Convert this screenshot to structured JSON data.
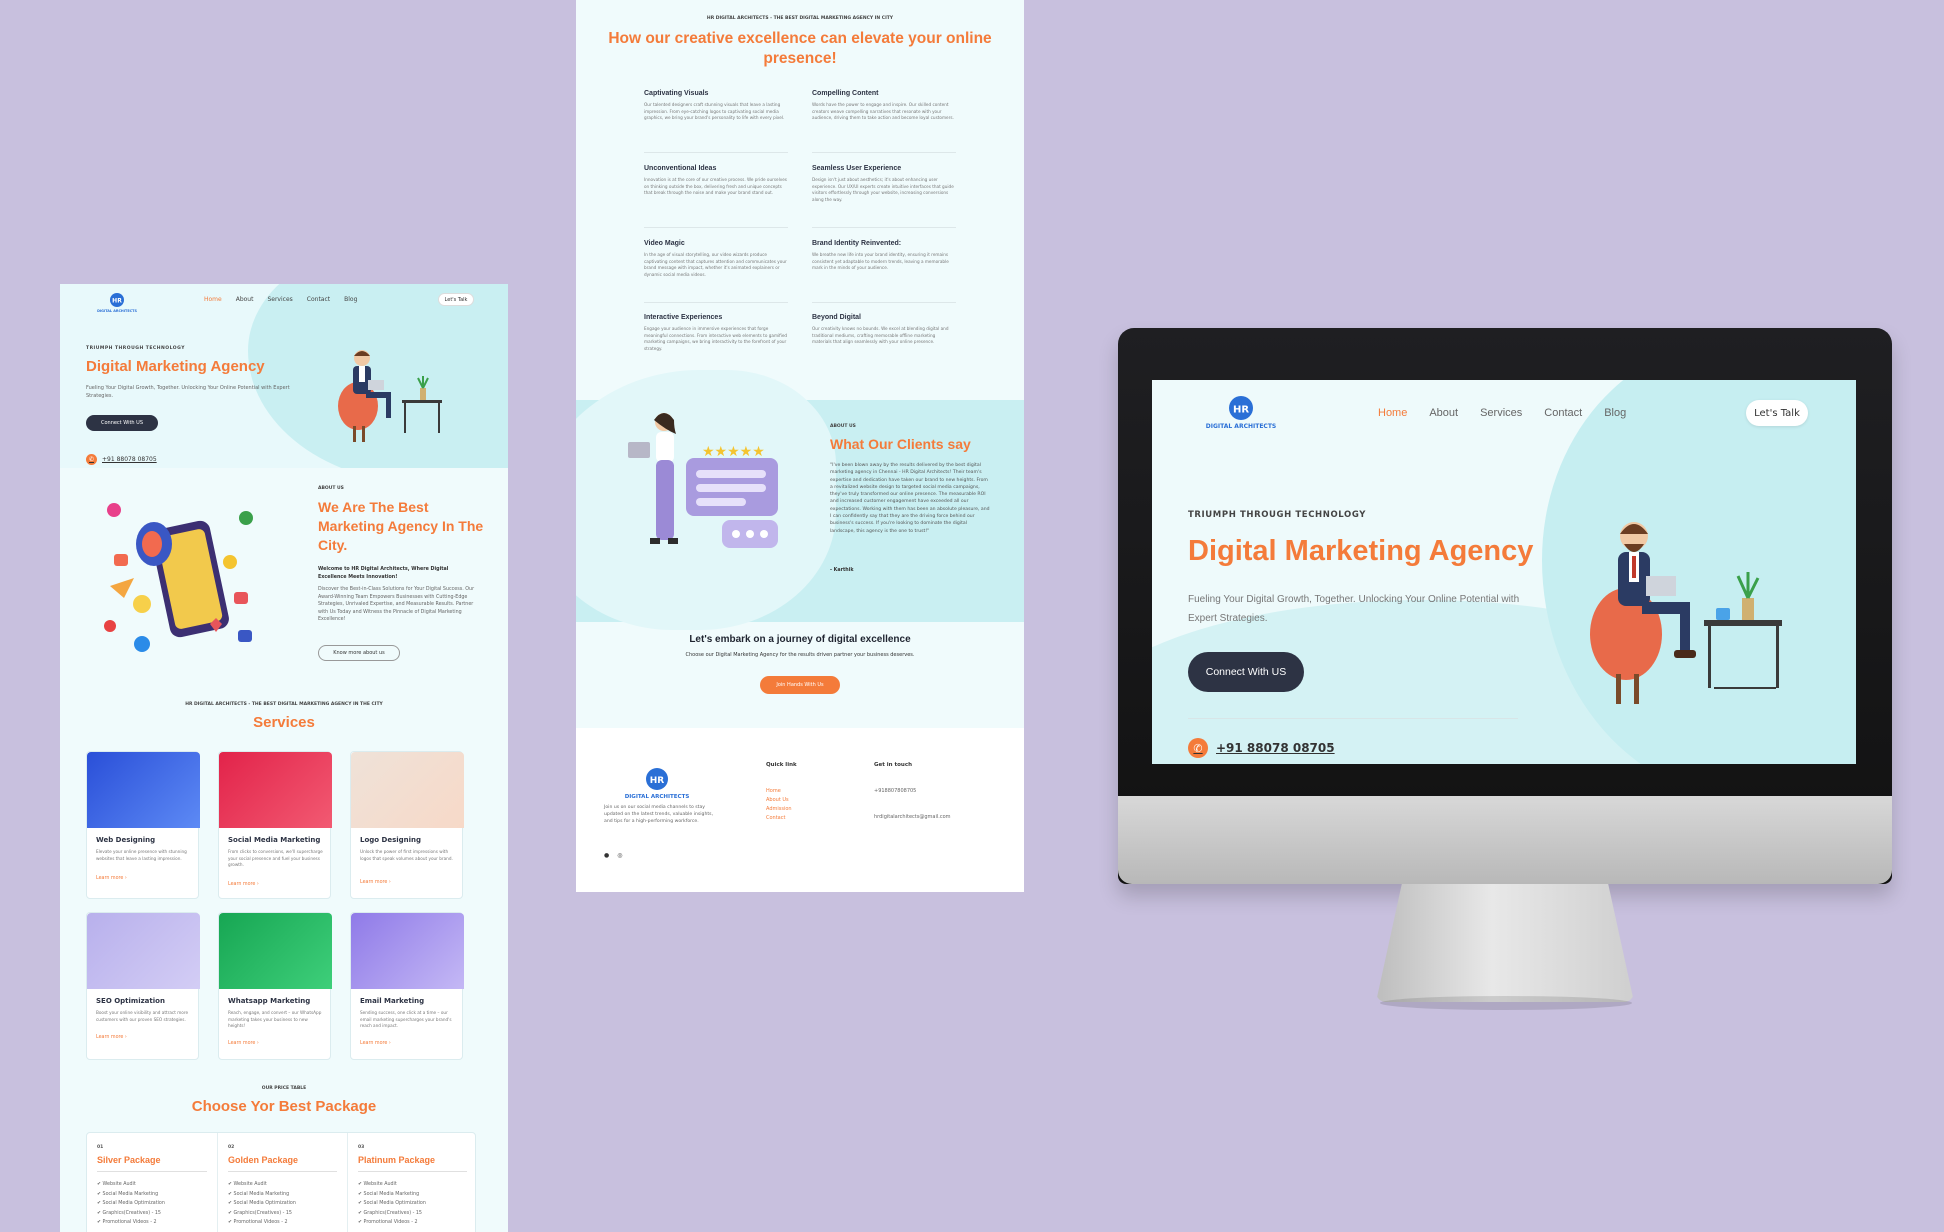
{
  "nav": {
    "items": [
      {
        "label": "Home",
        "active": true
      },
      {
        "label": "About",
        "active": false
      },
      {
        "label": "Services",
        "active": false
      },
      {
        "label": "Contact",
        "active": false
      },
      {
        "label": "Blog",
        "active": false
      }
    ],
    "cta": "Let's Talk",
    "logo_text": "HR",
    "logo_caption": "DIGITAL ARCHITECTS"
  },
  "hero": {
    "kicker": "TRIUMPH THROUGH TECHNOLOGY",
    "title": "Digital Marketing Agency",
    "subtitle": "Fueling Your Digital Growth, Together. Unlocking Your Online Potential with Expert Strategies.",
    "button": "Connect With US",
    "phone": "+91 88078 08705"
  },
  "about": {
    "kicker": "ABOUT US",
    "title": "We Are The Best Marketing Agency In The City.",
    "lead": "Welcome to HR Digital Architects, Where Digital Excellence Meets Innovation!",
    "body": "Discover the Best-in-Class Solutions for Your Digital Success. Our Award-Winning Team Empowers Businesses with Cutting-Edge Strategies, Unrivaled Expertise, and Measurable Results. Partner with Us Today and Witness the Pinnacle of Digital Marketing Excellence!",
    "button": "Know more about us"
  },
  "services": {
    "kicker": "HR DIGITAL ARCHITECTS - THE BEST DIGITAL MARKETING AGENCY IN THE CITY",
    "title": "Services",
    "more": "Learn more ›",
    "items": [
      {
        "name": "Web Designing",
        "desc": "Elevate your online presence with stunning websites that leave a lasting impression."
      },
      {
        "name": "Social Media Marketing",
        "desc": "From clicks to conversions, we'll supercharge your social presence and fuel your business growth."
      },
      {
        "name": "Logo Designing",
        "desc": "Unlock the power of first impressions with logos that speak volumes about your brand."
      },
      {
        "name": "SEO Optimization",
        "desc": "Boost your online visibility and attract more customers with our proven SEO strategies."
      },
      {
        "name": "Whatsapp Marketing",
        "desc": "Reach, engage, and convert – our WhatsApp marketing takes your business to new heights!"
      },
      {
        "name": "Email Marketing",
        "desc": "Sending success, one click at a time – our email marketing supercharges your brand's reach and impact."
      }
    ]
  },
  "pricing": {
    "kicker": "OUR PRICE TABLE",
    "title": "Choose Yor Best Package",
    "plans": [
      {
        "num": "01",
        "name": "Silver Package",
        "features": [
          "✔ Website Audit",
          "✔ Social Media Marketing",
          "✔ Social Media Optimization",
          "✔ Graphics(Creatives) - 15",
          "✔ Promotional Videos - 2"
        ]
      },
      {
        "num": "02",
        "name": "Golden Package",
        "features": [
          "✔ Website Audit",
          "✔ Social Media Marketing",
          "✔ Social Media Optimization",
          "✔ Graphics(Creatives) - 15",
          "✔ Promotional Videos - 2"
        ]
      },
      {
        "num": "03",
        "name": "Platinum Package",
        "features": [
          "✔ Website Audit",
          "✔ Social Media Marketing",
          "✔ Social Media Optimization",
          "✔ Graphics(Creatives) - 15",
          "✔ Promotional Videos - 2"
        ]
      }
    ]
  },
  "excellence": {
    "kicker": "HR DIGITAL ARCHITECTS - THE BEST DIGITAL MARKETING AGENCY IN CITY",
    "title": "How our creative excellence can elevate your online presence!",
    "items": [
      {
        "name": "Captivating Visuals",
        "desc": "Our talented designers craft stunning visuals that leave a lasting impression. From eye-catching logos to captivating social media graphics, we bring your brand's personality to life with every pixel."
      },
      {
        "name": "Compelling Content",
        "desc": "Words have the power to engage and inspire. Our skilled content creators weave compelling narratives that resonate with your audience, driving them to take action and become loyal customers."
      },
      {
        "name": "Unconventional Ideas",
        "desc": "Innovation is at the core of our creative process. We pride ourselves on thinking outside the box, delivering fresh and unique concepts that break through the noise and make your brand stand out."
      },
      {
        "name": "Seamless User Experience",
        "desc": "Design isn't just about aesthetics; it's about enhancing user experience. Our UX/UI experts create intuitive interfaces that guide visitors effortlessly through your website, increasing conversions along the way."
      },
      {
        "name": "Video Magic",
        "desc": "In the age of visual storytelling, our video wizards produce captivating content that captures attention and communicates your brand message with impact, whether it's animated explainers or dynamic social media videos."
      },
      {
        "name": "Brand Identity Reinvented:",
        "desc": "We breathe new life into your brand identity, ensuring it remains consistent yet adaptable to modern trends, leaving a memorable mark in the minds of your audience."
      },
      {
        "name": "Interactive Experiences",
        "desc": "Engage your audience in immersive experiences that forge meaningful connections. From interactive web elements to gamified marketing campaigns, we bring interactivity to the forefront of your strategy."
      },
      {
        "name": "Beyond Digital",
        "desc": "Our creativity knows no bounds. We excel at blending digital and traditional mediums, crafting memorable offline marketing materials that align seamlessly with your online presence."
      }
    ]
  },
  "clients": {
    "kicker": "ABOUT US",
    "title": "What Our Clients say",
    "quote": "\"I've been blown away by the results delivered by the best digital marketing agency in Chennai - HR Digital Architects! Their team's expertise and dedication have taken our brand to new heights. From a revitalized website design to targeted social media campaigns, they've truly transformed our online presence. The measurable ROI and increased customer engagement have exceeded all our expectations. Working with them has been an absolute pleasure, and I can confidently say that they are the driving force behind our business's success. If you're looking to dominate the digital landscape, this agency is the one to trust!\"",
    "author": "- Karthik"
  },
  "cta": {
    "title": "Let's embark on a journey of digital excellence",
    "subtitle": "Choose our Digital Marketing Agency for the results driven partner your business deserves.",
    "button": "Join Hands With Us"
  },
  "footer": {
    "text": "Join us on our social media channels to stay updated on the latest trends, valuable insights, and tips for a high-performing workforce.",
    "quick_title": "Quick link",
    "quick_links": [
      "Home",
      "About Us",
      "Admission",
      "Contact"
    ],
    "touch_title": "Get in touch",
    "phone": "+918807808705",
    "email": "hrdigitalarchitects@gmail.com"
  },
  "colors": {
    "accent": "#f47b3a",
    "dark": "#2d3344",
    "page_bg": "#c8c0de",
    "hero_bg": "#c9eff2"
  }
}
